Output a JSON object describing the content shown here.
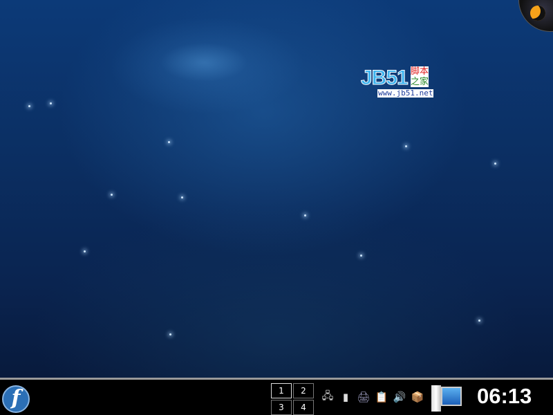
{
  "watermark": {
    "brand": "JB51",
    "cn_line1": "脚本",
    "cn_line2": "之家",
    "url": "www.jb51.net"
  },
  "taskbar": {
    "launcher": {
      "icon": "fedora-logo-icon",
      "glyph": "f"
    },
    "pager": {
      "desktops": [
        "1",
        "2",
        "3",
        "4"
      ],
      "active": "1"
    },
    "tray": [
      {
        "name": "network-icon",
        "glyph": "🖧"
      },
      {
        "name": "klipper-icon",
        "glyph": "▮"
      },
      {
        "name": "printer-applet-icon",
        "glyph": "🖨"
      },
      {
        "name": "clipboard-icon",
        "glyph": "📋"
      },
      {
        "name": "volume-icon",
        "glyph": "🔊"
      },
      {
        "name": "package-updater-icon",
        "glyph": "📦"
      }
    ],
    "clock": "06:13"
  },
  "colors": {
    "accent": "#3db4ef",
    "taskbar": "#000000"
  }
}
